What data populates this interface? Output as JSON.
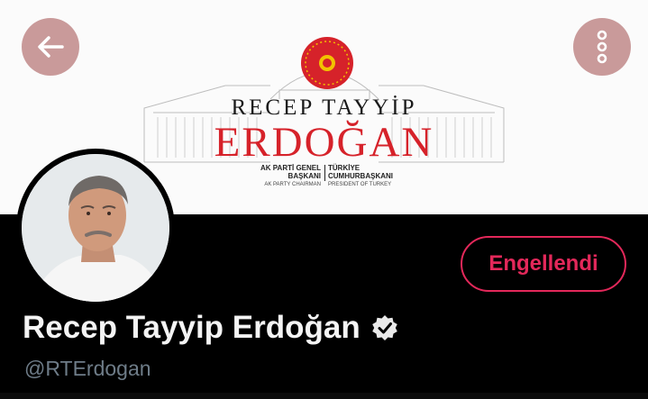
{
  "banner": {
    "name_line1": "RECEP TAYYİP",
    "name_line2": "ERDOĞAN",
    "left_title": "AK PARTİ GENEL BAŞKANI",
    "left_subtitle": "AK PARTY CHAIRMAN",
    "right_title": "TÜRKİYE CUMHURBAŞKANI",
    "right_subtitle": "PRESIDENT OF TURKEY",
    "seal_color": "#d6222a",
    "name_color": "#d6222a"
  },
  "nav": {
    "back_icon": "arrow-left-icon",
    "more_icon": "more-vertical-icon",
    "button_color": "#c99a9a"
  },
  "profile": {
    "block_status_label": "Engellendi",
    "display_name": "Recep Tayyip Erdoğan",
    "verified_icon": "verified-badge-icon",
    "handle": "@RTErdogan",
    "accent_color": "#e3285a"
  }
}
